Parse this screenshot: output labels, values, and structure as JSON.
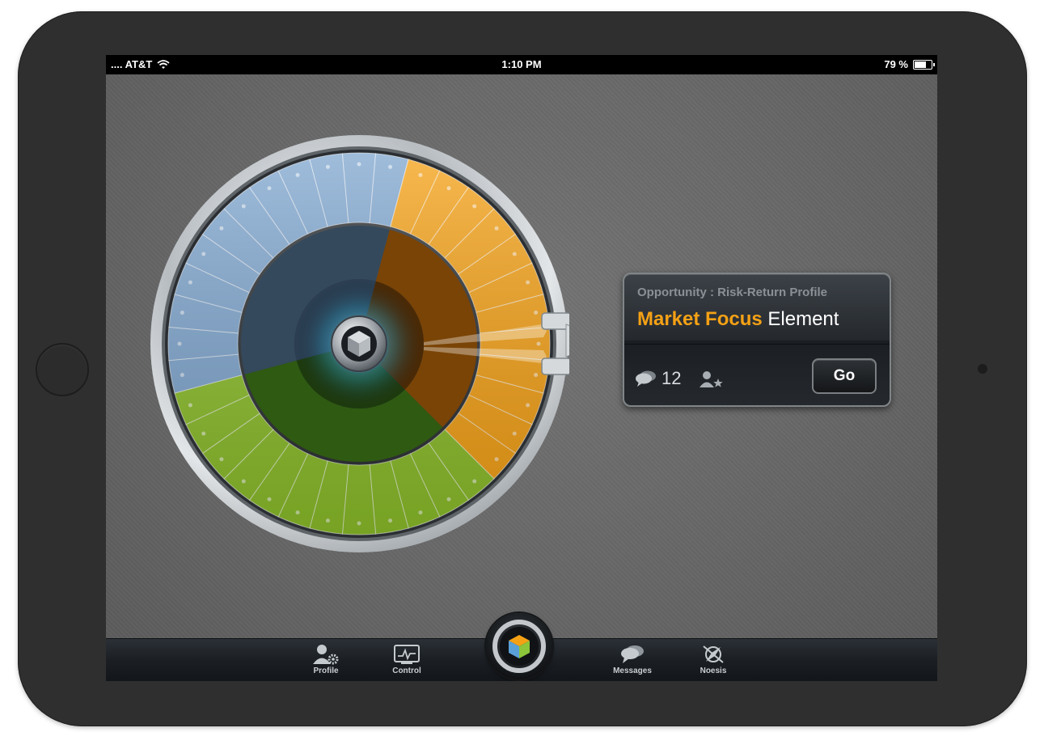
{
  "status_bar": {
    "carrier": ".... AT&T",
    "time": "1:10 PM",
    "battery": "79 %",
    "battery_level": 0.79
  },
  "info_card": {
    "subtitle": "Opportunity : Risk-Return Profile",
    "title_highlight": "Market Focus",
    "title_rest": "Element",
    "comment_count": "12",
    "go_label": "Go"
  },
  "tabs": [
    {
      "label": "Profile",
      "icon": "profile-gear-icon"
    },
    {
      "label": "Control",
      "icon": "control-monitor-icon"
    },
    {
      "label": "Messages",
      "icon": "messages-icon"
    },
    {
      "label": "Noesis",
      "icon": "noesis-compass-icon"
    }
  ],
  "colors": {
    "orange": "#f5a115",
    "blue": "#7fa6cf",
    "green": "#8cbf2a",
    "chrome": "#c7cbcf"
  },
  "wheel": {
    "segments": [
      {
        "name": "blue",
        "start_deg": -105,
        "end_deg": 15,
        "cells": 12
      },
      {
        "name": "orange",
        "start_deg": 15,
        "end_deg": 135,
        "cells": 12
      },
      {
        "name": "green",
        "start_deg": 135,
        "end_deg": 255,
        "cells": 12
      }
    ]
  }
}
